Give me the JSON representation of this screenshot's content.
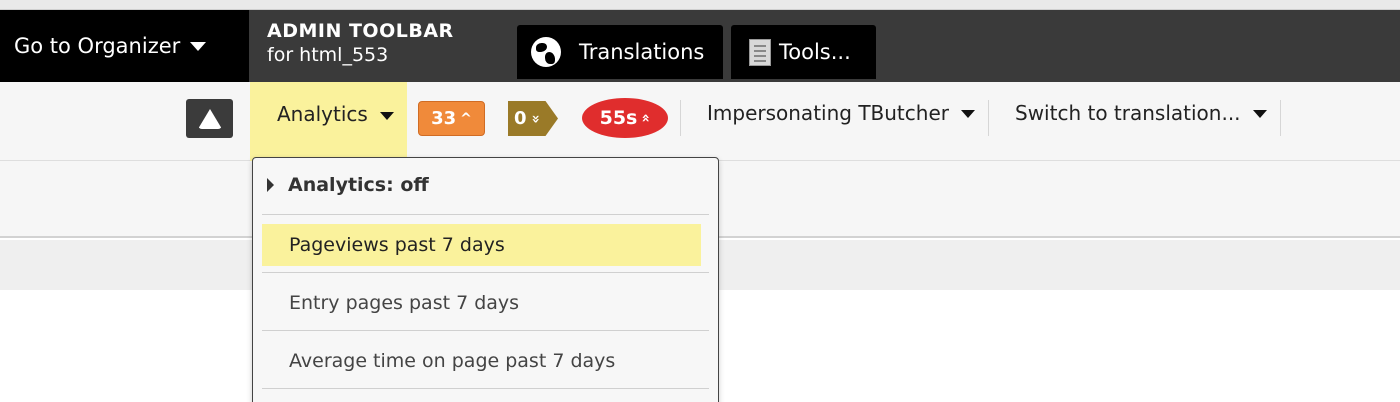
{
  "header": {
    "organizer_label": "Go to Organizer",
    "admin_title": "ADMIN TOOLBAR",
    "admin_subtitle": "for html_553",
    "tabs": [
      {
        "label": "Translations",
        "icon": "globe-icon"
      },
      {
        "label": "Tools...",
        "icon": "document-icon"
      }
    ]
  },
  "toolbar": {
    "up_icon": "triangle-up-icon",
    "analytics_label": "Analytics",
    "badges": {
      "orange": {
        "value": "33",
        "chevron": "^",
        "color": "#f08a3a"
      },
      "olive": {
        "value": "0",
        "chevron": "»",
        "color": "#9a7a28"
      },
      "red": {
        "value": "55s",
        "chevron": "«",
        "color": "#e02d2d"
      }
    },
    "impersonating_label": "Impersonating TButcher",
    "switch_label": "Switch to translation..."
  },
  "dropdown": {
    "header": "Analytics: off",
    "items": [
      {
        "label": "Pageviews past 7 days",
        "active": true
      },
      {
        "label": "Entry pages past 7 days",
        "active": false
      },
      {
        "label": "Average time on page past 7 days",
        "active": false
      }
    ]
  },
  "colors": {
    "highlight": "#faf29c",
    "dark_bar": "#3a3a3a"
  }
}
